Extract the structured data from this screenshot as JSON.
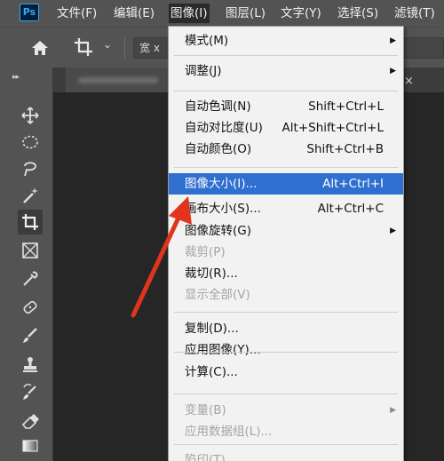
{
  "app": {
    "logo_text": "Ps"
  },
  "menubar": {
    "items": [
      {
        "label": "文件(F)"
      },
      {
        "label": "编辑(E)"
      },
      {
        "label": "图像(I)"
      },
      {
        "label": "图层(L)"
      },
      {
        "label": "文字(Y)"
      },
      {
        "label": "选择(S)"
      },
      {
        "label": "滤镜(T)"
      }
    ],
    "active_index": 2
  },
  "options_bar": {
    "chevron": "⌄",
    "ratio_field_value": "宽 x"
  },
  "tabs": {
    "close_glyph": "×"
  },
  "image_menu": {
    "items": [
      {
        "label": "模式(M)",
        "shortcut": "",
        "submenu": true,
        "disabled": false,
        "highlighted": false
      },
      {
        "label": "调整(J)",
        "shortcut": "",
        "submenu": true,
        "disabled": false,
        "highlighted": false
      },
      {
        "label": "自动色调(N)",
        "shortcut": "Shift+Ctrl+L",
        "submenu": false,
        "disabled": false,
        "highlighted": false
      },
      {
        "label": "自动对比度(U)",
        "shortcut": "Alt+Shift+Ctrl+L",
        "submenu": false,
        "disabled": false,
        "highlighted": false
      },
      {
        "label": "自动颜色(O)",
        "shortcut": "Shift+Ctrl+B",
        "submenu": false,
        "disabled": false,
        "highlighted": false
      },
      {
        "label": "图像大小(I)...",
        "shortcut": "Alt+Ctrl+I",
        "submenu": false,
        "disabled": false,
        "highlighted": true
      },
      {
        "label": "画布大小(S)...",
        "shortcut": "Alt+Ctrl+C",
        "submenu": false,
        "disabled": false,
        "highlighted": false
      },
      {
        "label": "图像旋转(G)",
        "shortcut": "",
        "submenu": true,
        "disabled": false,
        "highlighted": false
      },
      {
        "label": "裁剪(P)",
        "shortcut": "",
        "submenu": false,
        "disabled": true,
        "highlighted": false
      },
      {
        "label": "裁切(R)...",
        "shortcut": "",
        "submenu": false,
        "disabled": false,
        "highlighted": false
      },
      {
        "label": "显示全部(V)",
        "shortcut": "",
        "submenu": false,
        "disabled": true,
        "highlighted": false
      },
      {
        "label": "复制(D)...",
        "shortcut": "",
        "submenu": false,
        "disabled": false,
        "highlighted": false
      },
      {
        "label": "应用图像(Y)...",
        "shortcut": "",
        "submenu": false,
        "disabled": false,
        "highlighted": false
      },
      {
        "label": "计算(C)...",
        "shortcut": "",
        "submenu": false,
        "disabled": false,
        "highlighted": false
      },
      {
        "label": "变量(B)",
        "shortcut": "",
        "submenu": true,
        "disabled": true,
        "highlighted": false
      },
      {
        "label": "应用数据组(L)...",
        "shortcut": "",
        "submenu": false,
        "disabled": true,
        "highlighted": false
      },
      {
        "label": "陷印(T)...",
        "shortcut": "",
        "submenu": false,
        "disabled": true,
        "highlighted": false
      }
    ]
  },
  "tools": [
    {
      "icon": "move-icon"
    },
    {
      "icon": "elliptical-marquee-icon"
    },
    {
      "icon": "lasso-icon"
    },
    {
      "icon": "magic-wand-icon"
    },
    {
      "icon": "crop-icon",
      "selected": true
    },
    {
      "icon": "frame-icon"
    },
    {
      "icon": "eyedropper-icon"
    },
    {
      "icon": "healing-brush-icon"
    },
    {
      "icon": "brush-icon"
    },
    {
      "icon": "clone-stamp-icon"
    },
    {
      "icon": "history-brush-icon"
    },
    {
      "icon": "eraser-icon"
    },
    {
      "icon": "gradient-icon"
    }
  ],
  "colors": {
    "menubar_bg": "#535353",
    "highlight": "#2f6fd0",
    "annotation_arrow": "#e0351c",
    "ps_brand": "#31a8ff"
  }
}
